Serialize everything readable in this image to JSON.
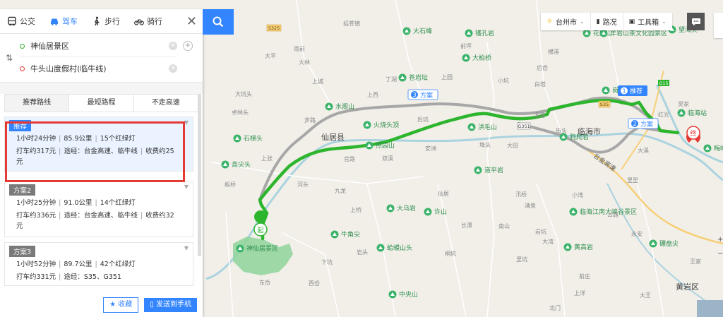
{
  "modes": [
    {
      "label": "公交",
      "icon": "bus-icon"
    },
    {
      "label": "驾车",
      "icon": "car-icon",
      "active": true
    },
    {
      "label": "步行",
      "icon": "walk-icon"
    },
    {
      "label": "骑行",
      "icon": "bike-icon"
    }
  ],
  "start_point": "神仙居景区",
  "end_point": "牛头山度假村(临牛线)",
  "preferences": [
    "推荐路线",
    "最短路程",
    "不走高速"
  ],
  "plans": [
    {
      "tag": "推荐",
      "time": "1小时24分钟",
      "distance": "85.9公里",
      "lights": "15个红绿灯",
      "taxi": "打车约317元",
      "via": "途经：台金高速、临牛线",
      "toll": "收费约25",
      "toll2": "元"
    },
    {
      "tag": "方案2",
      "time": "1小时25分钟",
      "distance": "91.0公里",
      "lights": "14个红绿灯",
      "taxi": "打车约336元",
      "via": "途经：台金高速、临牛线",
      "toll": "收费约32",
      "toll2": "元"
    },
    {
      "tag": "方案3",
      "time": "1小时52分钟",
      "distance": "89.7公里",
      "lights": "42个红绿灯",
      "taxi": "打车约331元",
      "via": "途经：S35、G351"
    }
  ],
  "actions": {
    "favorite": "收藏",
    "send": "发送到手机"
  },
  "toolbar": {
    "city": "台州市",
    "traffic": "路况",
    "toolbox": "工具箱"
  },
  "colors": {
    "accent": "#3385ff",
    "route_main": "#2db52d",
    "route_alt": "#a7a7a7",
    "highlight": "#e53935"
  },
  "map": {
    "route_labels": {
      "recommend": "推荐",
      "plan2": "方案",
      "plan3": "方案"
    },
    "markers": {
      "start": "起",
      "end": "终"
    },
    "highways": [
      "台金高速"
    ],
    "road_shields": [
      "S325",
      "G351",
      "G15",
      "S35"
    ],
    "places_green": [
      "大石峰",
      "镬孔岩",
      "花猫山",
      "羊岩山茶文化园景区",
      "望海尖",
      "临海站",
      "水阁山",
      "火烧头顶",
      "洪毛山",
      "照园山",
      "狗爬岩",
      "道平岩",
      "许山",
      "大乌岩",
      "牛角尖",
      "蛤蟆山头",
      "中央山",
      "石梯头",
      "黄高岩",
      "高尖头",
      "神仙居景区",
      "临海江南大峡谷景区",
      "梅峰顶",
      "碾盘尖",
      "岗里山",
      "大柏桥",
      "苍岩坛"
    ],
    "places_gray": [
      "括苍镇",
      "雨前",
      "大平",
      "上城",
      "上西",
      "丁湖",
      "大坑头",
      "大林",
      "卓林头",
      "后坑",
      "上园",
      "前坪",
      "小坑",
      "横溪",
      "白塔",
      "溪港",
      "步路",
      "埠头",
      "大田",
      "安洲",
      "官路",
      "双溪",
      "上张",
      "河头",
      "板桥",
      "上桥",
      "九龙",
      "仙居",
      "长潭",
      "南山",
      "岩坑",
      "桐坑",
      "里坑",
      "前庄",
      "下坑",
      "岩头",
      "西岙",
      "东岙",
      "北门",
      "上洋",
      "大溪",
      "红光",
      "公路",
      "永安",
      "吴家",
      "王家",
      "大王",
      "大湾",
      "小湾",
      "里里",
      "后岙",
      "街头",
      "涌泉",
      "汛桥"
    ],
    "cities": [
      "仙居县",
      "临海市",
      "黄岩区"
    ]
  }
}
